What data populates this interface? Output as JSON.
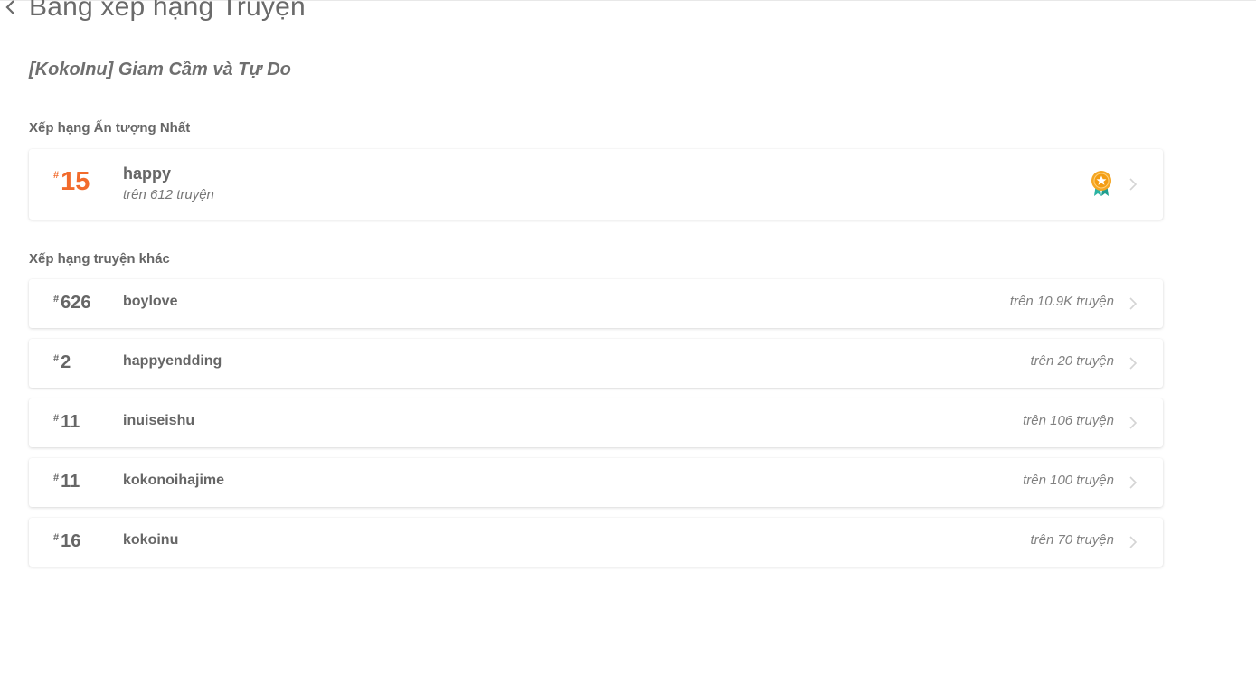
{
  "header": {
    "title": "Bảng xếp hạng Truyện",
    "back_icon": "chevron-left-icon"
  },
  "story": {
    "title": "[KokoInu] Giam Cầm và Tự Do"
  },
  "featured_section": {
    "label": "Xếp hạng Ấn tượng Nhất",
    "item": {
      "hash": "#",
      "rank": "15",
      "tag": "happy",
      "subtitle": "trên 612 truyện",
      "badge_icon": "medal-icon",
      "accent_color": "#f26b2c"
    }
  },
  "other_section": {
    "label": "Xếp hạng truyện khác",
    "items": [
      {
        "hash": "#",
        "rank": "626",
        "tag": "boylove",
        "count": "trên 10.9K truyện"
      },
      {
        "hash": "#",
        "rank": "2",
        "tag": "happyendding",
        "count": "trên 20 truyện"
      },
      {
        "hash": "#",
        "rank": "11",
        "tag": "inuiseishu",
        "count": "trên 106 truyện"
      },
      {
        "hash": "#",
        "rank": "11",
        "tag": "kokonoihajime",
        "count": "trên 100 truyện"
      },
      {
        "hash": "#",
        "rank": "16",
        "tag": "kokoinu",
        "count": "trên 70 truyện"
      }
    ]
  }
}
